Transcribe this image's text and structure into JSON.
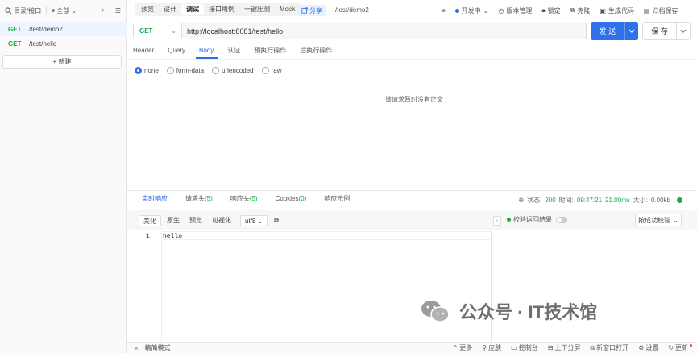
{
  "sidebar": {
    "search_label": "目录/接口",
    "filter_label": "全部",
    "items": [
      {
        "method": "GET",
        "path": "/test/demo2",
        "active": true
      },
      {
        "method": "GET",
        "path": "/test/hello",
        "active": false
      }
    ],
    "new_label": "+ 新建"
  },
  "top_tabs": [
    "预览",
    "设计",
    "调试",
    "接口用例",
    "一键压测",
    "Mock"
  ],
  "active_top_tab": "调试",
  "share_label": "分享",
  "breadcrumb": "/test/demo2",
  "toolbar": {
    "env_label": "开发中",
    "version_label": "版本管理",
    "lock_label": "锁定",
    "clone_label": "克隆",
    "codegen_label": "生成代码",
    "archive_label": "归档保存"
  },
  "request": {
    "method": "GET",
    "url": "http://localhost:8081/test/hello",
    "send_label": "发 送",
    "save_label": "保 存"
  },
  "request_tabs": [
    "Header",
    "Query",
    "Body",
    "认证",
    "预执行操作",
    "后执行操作"
  ],
  "active_request_tab": "Body",
  "body_options": [
    "none",
    "form-data",
    "urlencoded",
    "raw"
  ],
  "body_selected": "none",
  "no_body_text": "该请求暂时没有正文",
  "response_tabs": {
    "realtime": "实时响应",
    "req_headers": "请求头",
    "req_headers_count": "(5)",
    "res_headers": "响应头",
    "res_headers_count": "(5)",
    "cookies": "Cookies",
    "cookies_count": "(0)",
    "example": "响应示例"
  },
  "response_info": {
    "status_label": "状态:",
    "status": "200",
    "time_label": "时间:",
    "time": "09:47:21",
    "duration": "21.00ms",
    "size_label": "大小:",
    "size": "0.00kb"
  },
  "view_tabs": [
    "美化",
    "原生",
    "预览",
    "可视化"
  ],
  "active_view_tab": "美化",
  "encoding": "utf8",
  "verify": {
    "label": "校验返回结果",
    "select_label": "按成功校验"
  },
  "editor": {
    "line_number": "1",
    "content": "hello"
  },
  "watermark": "公众号 · IT技术馆",
  "bottom_bar": {
    "mode_label": "精简模式",
    "more": "更多",
    "skin": "皮肤",
    "console": "控制台",
    "split": "上下分屏",
    "new_window": "新窗口打开",
    "settings": "设置",
    "update": "更新"
  },
  "colors": {
    "accent": "#2f6fe8",
    "method_get": "#1ba94c",
    "success": "#1ba94c"
  }
}
